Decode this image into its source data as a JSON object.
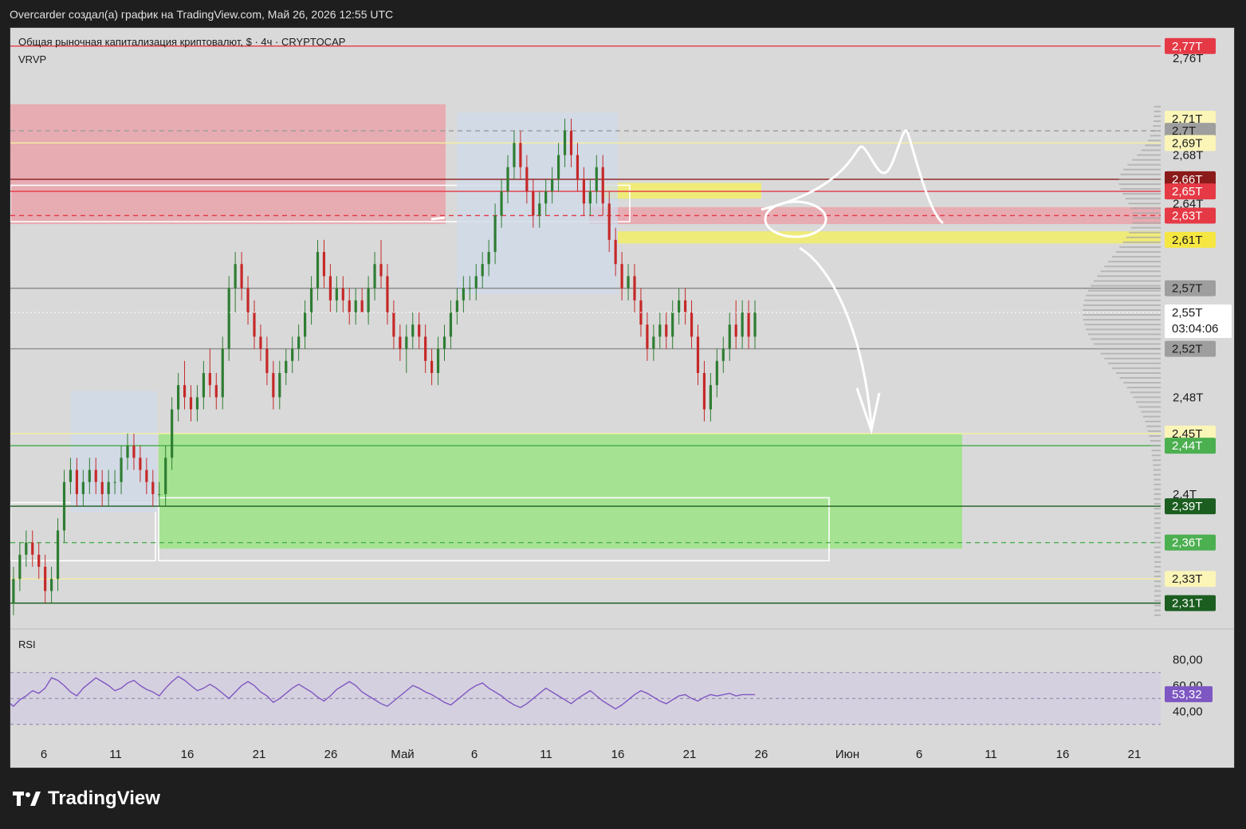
{
  "header": {
    "title": "Overcarder создал(а) график на TradingView.com, Май 26, 2026 12:55 UTC"
  },
  "legend": {
    "symbol": "Общая рыночная капитализация криптовалют, $ · 4ч · CRYPTOCAP",
    "indicator": "VRVP"
  },
  "rsi": {
    "label": "RSI",
    "ticks": [
      "80,00",
      "60,00",
      "40,00"
    ],
    "current_label": "53,32"
  },
  "countdown": "03:04:06",
  "brand": "TradingView",
  "colors": {
    "background": "#d9d9d9",
    "candle_up": "#2e7d32",
    "candle_down": "#c62828",
    "rsi_line": "#7e57c2",
    "green_zone": "#9ee38a",
    "red_zone": "#e8a5ad",
    "yellow_zone": "#f1ec6e"
  },
  "chart_data": [
    {
      "type": "candlestick",
      "title": "Общая рыночная капитализация криптовалют, $ · 4ч · CRYPTOCAP",
      "xlabel": "",
      "ylabel": "",
      "ylim": [
        2.29,
        2.785
      ],
      "grid": false,
      "x_ticks": [
        "6",
        "11",
        "16",
        "21",
        "26",
        "Май",
        "6",
        "11",
        "16",
        "21",
        "26",
        "Июн",
        "6",
        "11",
        "16",
        "21"
      ],
      "x_tick_dates": [
        "2026-04-06",
        "2026-04-11",
        "2026-04-16",
        "2026-04-21",
        "2026-04-26",
        "2026-05-01",
        "2026-05-06",
        "2026-05-11",
        "2026-05-16",
        "2026-05-21",
        "2026-05-26",
        "2026-06-01",
        "2026-06-06",
        "2026-06-11",
        "2026-06-16",
        "2026-06-21"
      ],
      "y_ticks": [
        {
          "label": "2,76T",
          "value": 2.76
        },
        {
          "label": "2,68T",
          "value": 2.68
        },
        {
          "label": "2,64T",
          "value": 2.64
        },
        {
          "label": "2,48T",
          "value": 2.48
        },
        {
          "label": "2,4T",
          "value": 2.4
        }
      ],
      "price_labels": [
        {
          "label": "2,77T",
          "value": 2.77,
          "bg": "#e53945",
          "fg": "#ffffff"
        },
        {
          "label": "2,71T",
          "value": 2.71,
          "bg": "#fbf5b8",
          "fg": "#1a1a1a"
        },
        {
          "label": "2,7T",
          "value": 2.7,
          "bg": "#9e9e9e",
          "fg": "#1a1a1a"
        },
        {
          "label": "2,69T",
          "value": 2.69,
          "bg": "#fbf5b8",
          "fg": "#1a1a1a"
        },
        {
          "label": "2,66T",
          "value": 2.66,
          "bg": "#8b1a1a",
          "fg": "#ffffff"
        },
        {
          "label": "2,65T",
          "value": 2.65,
          "bg": "#e53945",
          "fg": "#ffffff"
        },
        {
          "label": "2,63T",
          "value": 2.63,
          "bg": "#e53945",
          "fg": "#ffffff"
        },
        {
          "label": "2,61T",
          "value": 2.61,
          "bg": "#f5e642",
          "fg": "#1a1a1a"
        },
        {
          "label": "2,57T",
          "value": 2.57,
          "bg": "#9e9e9e",
          "fg": "#1a1a1a"
        },
        {
          "label": "2,55T",
          "value": 2.55,
          "bg": "#ffffff",
          "fg": "#1a1a1a"
        },
        {
          "label": "2,52T",
          "value": 2.52,
          "bg": "#9e9e9e",
          "fg": "#1a1a1a"
        },
        {
          "label": "2,45T",
          "value": 2.45,
          "bg": "#fbf5b8",
          "fg": "#1a1a1a"
        },
        {
          "label": "2,44T",
          "value": 2.44,
          "bg": "#4caf50",
          "fg": "#ffffff"
        },
        {
          "label": "2,39T",
          "value": 2.39,
          "bg": "#1b5e20",
          "fg": "#ffffff"
        },
        {
          "label": "2,36T",
          "value": 2.36,
          "bg": "#4caf50",
          "fg": "#ffffff"
        },
        {
          "label": "2,33T",
          "value": 2.33,
          "bg": "#fbf5b8",
          "fg": "#1a1a1a"
        },
        {
          "label": "2,31T",
          "value": 2.31,
          "bg": "#1b5e20",
          "fg": "#ffffff"
        }
      ],
      "horizontal_lines": [
        {
          "value": 2.77,
          "color": "#e53945",
          "dash": false
        },
        {
          "value": 2.7,
          "color": "#9e9e9e",
          "dash": true
        },
        {
          "value": 2.69,
          "color": "#f7f1a0",
          "dash": false
        },
        {
          "value": 2.66,
          "color": "#8b1a1a",
          "dash": false
        },
        {
          "value": 2.65,
          "color": "#e53945",
          "dash": false
        },
        {
          "value": 2.63,
          "color": "#e53945",
          "dash": true
        },
        {
          "value": 2.57,
          "color": "#8c8c8c",
          "dash": false
        },
        {
          "value": 2.52,
          "color": "#8c8c8c",
          "dash": false
        },
        {
          "value": 2.45,
          "color": "#f7f1a0",
          "dash": false
        },
        {
          "value": 2.44,
          "color": "#4caf50",
          "dash": false
        },
        {
          "value": 2.39,
          "color": "#1b5e20",
          "dash": false
        },
        {
          "value": 2.36,
          "color": "#4caf50",
          "dash": true
        },
        {
          "value": 2.33,
          "color": "#f7f1a0",
          "dash": false
        },
        {
          "value": 2.31,
          "color": "#1b5e20",
          "dash": false
        }
      ],
      "zones": [
        {
          "from": "2026-03-28",
          "to": "2026-05-04",
          "top": 2.722,
          "bottom": 2.623,
          "color": "#e8a5ad"
        },
        {
          "from": "2026-04-14",
          "to": "2026-06-09",
          "top": 2.45,
          "bottom": 2.355,
          "color": "#9ee38a"
        },
        {
          "from": "2026-05-15",
          "to": "2026-05-26",
          "top": 2.657,
          "bottom": 2.644,
          "color": "#f1ec6e"
        },
        {
          "from": "2026-05-16",
          "to": "2026-06-30",
          "top": 2.617,
          "bottom": 2.607,
          "color": "#f1ec6e"
        },
        {
          "from": "2026-05-14",
          "to": "2026-06-30",
          "top": 2.637,
          "bottom": 2.623,
          "color": "#e8a5ad"
        }
      ],
      "candles": [
        [
          2.3,
          2.31,
          2.29,
          2.3
        ],
        [
          2.3,
          2.32,
          2.29,
          2.31
        ],
        [
          2.31,
          2.34,
          2.3,
          2.33
        ],
        [
          2.33,
          2.36,
          2.32,
          2.35
        ],
        [
          2.35,
          2.37,
          2.34,
          2.36
        ],
        [
          2.36,
          2.37,
          2.34,
          2.35
        ],
        [
          2.35,
          2.36,
          2.33,
          2.34
        ],
        [
          2.34,
          2.35,
          2.31,
          2.32
        ],
        [
          2.32,
          2.34,
          2.31,
          2.33
        ],
        [
          2.33,
          2.38,
          2.32,
          2.37
        ],
        [
          2.37,
          2.42,
          2.36,
          2.41
        ],
        [
          2.41,
          2.43,
          2.4,
          2.42
        ],
        [
          2.42,
          2.43,
          2.39,
          2.4
        ],
        [
          2.4,
          2.42,
          2.39,
          2.41
        ],
        [
          2.41,
          2.43,
          2.4,
          2.42
        ],
        [
          2.42,
          2.43,
          2.4,
          2.41
        ],
        [
          2.41,
          2.42,
          2.39,
          2.4
        ],
        [
          2.4,
          2.42,
          2.39,
          2.41
        ],
        [
          2.41,
          2.42,
          2.4,
          2.41
        ],
        [
          2.41,
          2.44,
          2.4,
          2.43
        ],
        [
          2.43,
          2.45,
          2.42,
          2.44
        ],
        [
          2.44,
          2.45,
          2.42,
          2.43
        ],
        [
          2.43,
          2.44,
          2.41,
          2.42
        ],
        [
          2.42,
          2.43,
          2.4,
          2.41
        ],
        [
          2.41,
          2.42,
          2.39,
          2.4
        ],
        [
          2.4,
          2.41,
          2.39,
          2.4
        ],
        [
          2.4,
          2.44,
          2.39,
          2.43
        ],
        [
          2.43,
          2.48,
          2.42,
          2.47
        ],
        [
          2.47,
          2.5,
          2.46,
          2.49
        ],
        [
          2.49,
          2.51,
          2.47,
          2.48
        ],
        [
          2.48,
          2.49,
          2.46,
          2.47
        ],
        [
          2.47,
          2.49,
          2.46,
          2.48
        ],
        [
          2.48,
          2.51,
          2.47,
          2.5
        ],
        [
          2.5,
          2.52,
          2.48,
          2.49
        ],
        [
          2.49,
          2.5,
          2.47,
          2.48
        ],
        [
          2.48,
          2.53,
          2.47,
          2.52
        ],
        [
          2.52,
          2.58,
          2.51,
          2.57
        ],
        [
          2.57,
          2.6,
          2.55,
          2.59
        ],
        [
          2.59,
          2.6,
          2.56,
          2.57
        ],
        [
          2.57,
          2.58,
          2.54,
          2.55
        ],
        [
          2.55,
          2.56,
          2.52,
          2.53
        ],
        [
          2.53,
          2.54,
          2.51,
          2.52
        ],
        [
          2.52,
          2.53,
          2.49,
          2.5
        ],
        [
          2.5,
          2.51,
          2.47,
          2.48
        ],
        [
          2.48,
          2.51,
          2.47,
          2.5
        ],
        [
          2.5,
          2.52,
          2.49,
          2.51
        ],
        [
          2.51,
          2.53,
          2.5,
          2.52
        ],
        [
          2.52,
          2.54,
          2.51,
          2.53
        ],
        [
          2.53,
          2.56,
          2.52,
          2.55
        ],
        [
          2.55,
          2.58,
          2.54,
          2.57
        ],
        [
          2.57,
          2.61,
          2.56,
          2.6
        ],
        [
          2.6,
          2.61,
          2.57,
          2.58
        ],
        [
          2.58,
          2.59,
          2.55,
          2.56
        ],
        [
          2.56,
          2.58,
          2.55,
          2.57
        ],
        [
          2.57,
          2.58,
          2.55,
          2.56
        ],
        [
          2.56,
          2.57,
          2.54,
          2.55
        ],
        [
          2.55,
          2.57,
          2.54,
          2.56
        ],
        [
          2.56,
          2.57,
          2.55,
          2.55
        ],
        [
          2.55,
          2.58,
          2.54,
          2.57
        ],
        [
          2.57,
          2.6,
          2.56,
          2.59
        ],
        [
          2.59,
          2.61,
          2.57,
          2.58
        ],
        [
          2.58,
          2.59,
          2.54,
          2.55
        ],
        [
          2.55,
          2.56,
          2.52,
          2.53
        ],
        [
          2.53,
          2.54,
          2.51,
          2.52
        ],
        [
          2.52,
          2.54,
          2.5,
          2.53
        ],
        [
          2.53,
          2.55,
          2.52,
          2.54
        ],
        [
          2.54,
          2.55,
          2.52,
          2.53
        ],
        [
          2.53,
          2.54,
          2.5,
          2.51
        ],
        [
          2.51,
          2.52,
          2.49,
          2.5
        ],
        [
          2.5,
          2.53,
          2.49,
          2.52
        ],
        [
          2.52,
          2.54,
          2.51,
          2.53
        ],
        [
          2.53,
          2.56,
          2.52,
          2.55
        ],
        [
          2.55,
          2.57,
          2.54,
          2.56
        ],
        [
          2.56,
          2.58,
          2.55,
          2.57
        ],
        [
          2.57,
          2.58,
          2.56,
          2.57
        ],
        [
          2.57,
          2.59,
          2.56,
          2.58
        ],
        [
          2.58,
          2.6,
          2.57,
          2.59
        ],
        [
          2.59,
          2.61,
          2.58,
          2.6
        ],
        [
          2.6,
          2.64,
          2.59,
          2.63
        ],
        [
          2.63,
          2.66,
          2.62,
          2.65
        ],
        [
          2.65,
          2.68,
          2.64,
          2.67
        ],
        [
          2.67,
          2.7,
          2.66,
          2.69
        ],
        [
          2.69,
          2.7,
          2.66,
          2.67
        ],
        [
          2.67,
          2.68,
          2.64,
          2.65
        ],
        [
          2.65,
          2.66,
          2.62,
          2.63
        ],
        [
          2.63,
          2.65,
          2.62,
          2.64
        ],
        [
          2.64,
          2.66,
          2.63,
          2.65
        ],
        [
          2.65,
          2.67,
          2.64,
          2.66
        ],
        [
          2.66,
          2.69,
          2.65,
          2.68
        ],
        [
          2.68,
          2.71,
          2.67,
          2.7
        ],
        [
          2.7,
          2.71,
          2.67,
          2.68
        ],
        [
          2.68,
          2.69,
          2.65,
          2.66
        ],
        [
          2.66,
          2.67,
          2.63,
          2.64
        ],
        [
          2.64,
          2.66,
          2.63,
          2.65
        ],
        [
          2.65,
          2.68,
          2.64,
          2.67
        ],
        [
          2.67,
          2.68,
          2.63,
          2.64
        ],
        [
          2.64,
          2.65,
          2.6,
          2.61
        ],
        [
          2.61,
          2.62,
          2.58,
          2.59
        ],
        [
          2.59,
          2.6,
          2.56,
          2.57
        ],
        [
          2.57,
          2.59,
          2.56,
          2.58
        ],
        [
          2.58,
          2.59,
          2.55,
          2.56
        ],
        [
          2.56,
          2.57,
          2.53,
          2.54
        ],
        [
          2.54,
          2.55,
          2.51,
          2.52
        ],
        [
          2.52,
          2.54,
          2.51,
          2.53
        ],
        [
          2.53,
          2.55,
          2.52,
          2.54
        ],
        [
          2.54,
          2.55,
          2.52,
          2.53
        ],
        [
          2.53,
          2.56,
          2.52,
          2.55
        ],
        [
          2.55,
          2.57,
          2.54,
          2.56
        ],
        [
          2.56,
          2.57,
          2.54,
          2.55
        ],
        [
          2.55,
          2.56,
          2.52,
          2.53
        ],
        [
          2.53,
          2.54,
          2.49,
          2.5
        ],
        [
          2.5,
          2.51,
          2.46,
          2.47
        ],
        [
          2.47,
          2.5,
          2.46,
          2.49
        ],
        [
          2.49,
          2.52,
          2.48,
          2.51
        ],
        [
          2.51,
          2.53,
          2.5,
          2.52
        ],
        [
          2.52,
          2.55,
          2.51,
          2.54
        ],
        [
          2.54,
          2.56,
          2.52,
          2.53
        ],
        [
          2.53,
          2.56,
          2.52,
          2.55
        ],
        [
          2.55,
          2.56,
          2.52,
          2.53
        ],
        [
          2.53,
          2.56,
          2.52,
          2.55
        ]
      ]
    },
    {
      "type": "line",
      "title": "RSI",
      "ylim": [
        20,
        100
      ],
      "y_ticks": [
        80,
        60,
        40
      ],
      "band": [
        70,
        30
      ],
      "values": [
        45,
        48,
        44,
        49,
        52,
        56,
        54,
        58,
        66,
        64,
        60,
        55,
        52,
        58,
        62,
        66,
        63,
        60,
        56,
        58,
        62,
        64,
        60,
        57,
        55,
        52,
        58,
        63,
        67,
        64,
        60,
        56,
        58,
        61,
        58,
        54,
        50,
        55,
        60,
        63,
        60,
        55,
        52,
        47,
        50,
        54,
        58,
        61,
        58,
        55,
        51,
        48,
        52,
        57,
        60,
        63,
        60,
        55,
        52,
        49,
        46,
        44,
        48,
        52,
        56,
        60,
        58,
        55,
        53,
        50,
        47,
        45,
        49,
        53,
        57,
        60,
        62,
        58,
        55,
        52,
        48,
        45,
        43,
        46,
        50,
        54,
        58,
        55,
        52,
        49,
        46,
        50,
        53,
        56,
        52,
        48,
        45,
        42,
        45,
        49,
        53,
        56,
        54,
        51,
        48,
        46,
        49,
        52,
        53,
        50,
        48,
        51,
        53,
        52,
        53,
        54,
        52,
        53,
        53,
        53
      ]
    }
  ]
}
